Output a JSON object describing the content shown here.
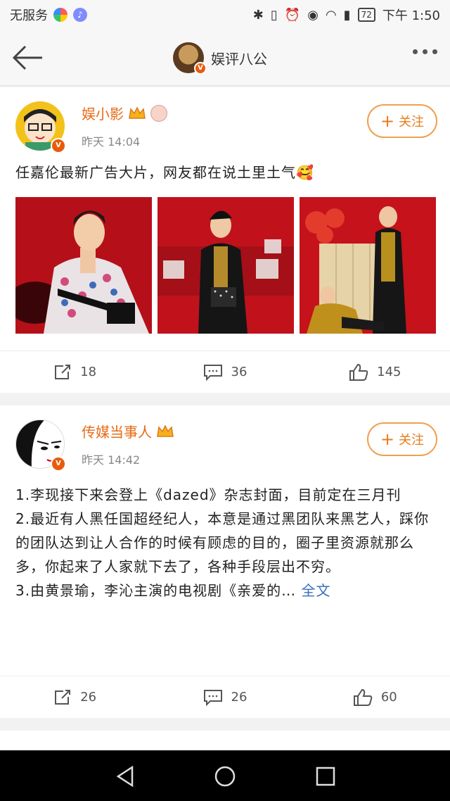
{
  "status_bar": {
    "carrier": "无服务",
    "battery": "72",
    "time": "下午 1:50"
  },
  "nav": {
    "title": "娱评八公",
    "back_icon": "arrow-left-icon",
    "more_icon": "more-dots-icon"
  },
  "posts": [
    {
      "username": "娱小影",
      "time": "昨天 14:04",
      "follow_label": "关注",
      "text": "任嘉伦最新广告大片，网友都在说土里土气🥰",
      "actions": {
        "repost": "18",
        "comment": "36",
        "like": "145"
      }
    },
    {
      "username": "传媒当事人",
      "time": "昨天 14:42",
      "follow_label": "关注",
      "lines": [
        "1.李现接下来会登上《dazed》杂志封面，目前定在三月刊",
        "2.最近有人黑任国超经纪人，本意是通过黑团队来黑艺人，踩你的团队达到让人合作的时候有顾虑的目的，圈子里资源就那么多，你起来了人家就下去了，各种手段层出不穷。",
        "3.由黄景瑜，李沁主演的电视剧《亲爱的…"
      ],
      "full_text_link": "全文",
      "actions": {
        "repost": "26",
        "comment": "26",
        "like": "60"
      }
    }
  ],
  "colors": {
    "accent": "#e86a14",
    "link": "#3a6fbd",
    "badge": "#e85b0c"
  }
}
